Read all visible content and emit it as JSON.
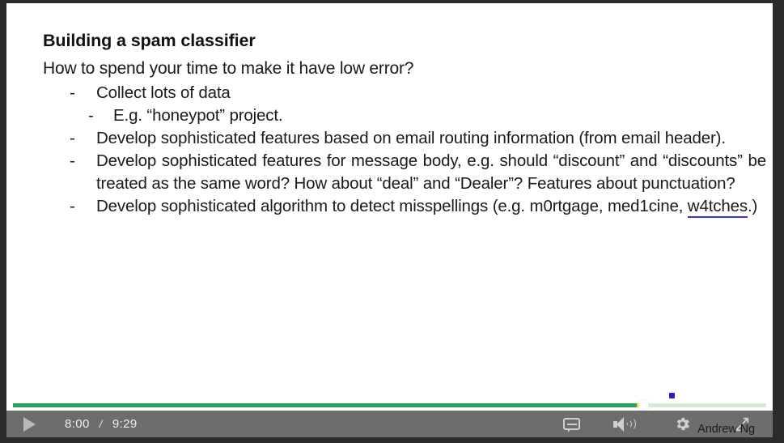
{
  "slide": {
    "title": "Building a spam classifier",
    "subtitle": "How to spend your time to make it have low error?",
    "bullets": [
      {
        "level": 1,
        "marker": "-",
        "text": "Collect lots of data"
      },
      {
        "level": 2,
        "marker": "-",
        "text": "E.g. “honeypot” project."
      },
      {
        "level": 1,
        "marker": "-",
        "text": "Develop sophisticated features based on email routing information (from email header)."
      },
      {
        "level": 1,
        "marker": "-",
        "text": "Develop sophisticated features for message body, e.g. should “discount” and “discounts” be treated as the same word? How about “deal” and “Dealer”? Features about punctuation?"
      },
      {
        "level": 1,
        "marker": "-",
        "text_before": "Develop sophisticated algorithm to detect misspellings (e.g. m0rtgage, med1cine, ",
        "text_underlined": "w4tches",
        "text_after": ".)"
      }
    ],
    "signature": "Andrew Ng"
  },
  "player": {
    "play_label": "play-icon",
    "current_time": "8:00",
    "time_separator": "/",
    "total_time": "9:29",
    "progress_percent": 82.8,
    "buffer_percent": 0.9,
    "controls": {
      "cc": "subtitles-icon",
      "volume": "volume-icon",
      "settings": "settings-gear-icon",
      "fullscreen": "fullscreen-icon"
    },
    "colors": {
      "progress_played": "#24a45e",
      "progress_buffer": "#f0e400",
      "progress_remaining": "#d3ead9",
      "control_bar": "#6d6d6d",
      "chapter_marker": "#2a1fbd",
      "underline": "#3b37d6"
    }
  }
}
